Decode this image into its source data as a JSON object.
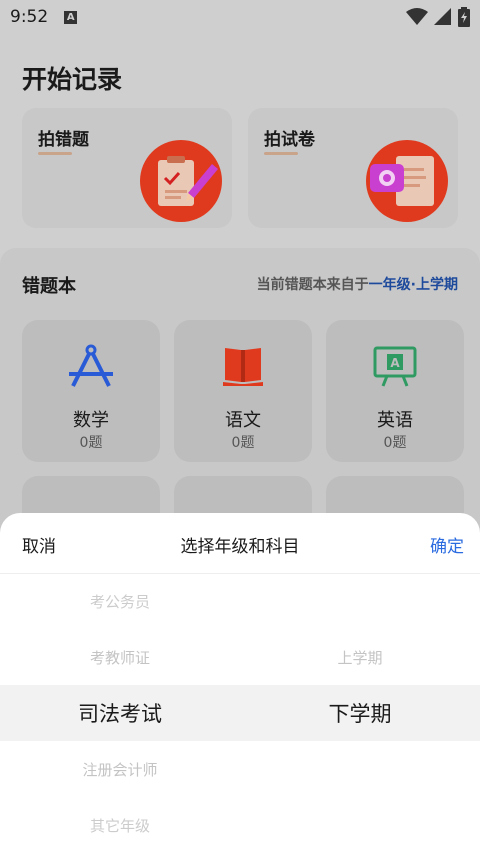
{
  "status_bar": {
    "time": "9:52",
    "notification_icon": "a-icon",
    "icons": [
      "wifi-icon",
      "signal-icon",
      "battery-icon"
    ]
  },
  "start": {
    "title": "开始记录",
    "cards": [
      {
        "label": "拍错题",
        "icon": "clipboard-pen-icon"
      },
      {
        "label": "拍试卷",
        "icon": "camera-document-icon"
      }
    ]
  },
  "notebook": {
    "title": "错题本",
    "hint_prefix": "当前错题本来自于",
    "hint_grade": "一年级·上学期",
    "subjects": [
      {
        "name": "数学",
        "count": "0题",
        "icon": "compass-icon"
      },
      {
        "name": "语文",
        "count": "0题",
        "icon": "book-icon"
      },
      {
        "name": "英语",
        "count": "0题",
        "icon": "english-board-icon"
      }
    ]
  },
  "sheet": {
    "cancel": "取消",
    "title": "选择年级和科目",
    "confirm": "确定",
    "left_column": [
      "考公务员",
      "考教师证",
      "司法考试",
      "注册会计师",
      "其它年级"
    ],
    "left_selected": "司法考试",
    "right_column": [
      "上学期",
      "下学期"
    ],
    "right_selected": "下学期"
  },
  "colors": {
    "accent": "#2a6be0",
    "grade_link": "#1e4a9c",
    "overlay": "#cfcfcf",
    "icon_red": "#e03a1e",
    "icon_blue": "#2a5bd7",
    "icon_green": "#2f9a62"
  }
}
